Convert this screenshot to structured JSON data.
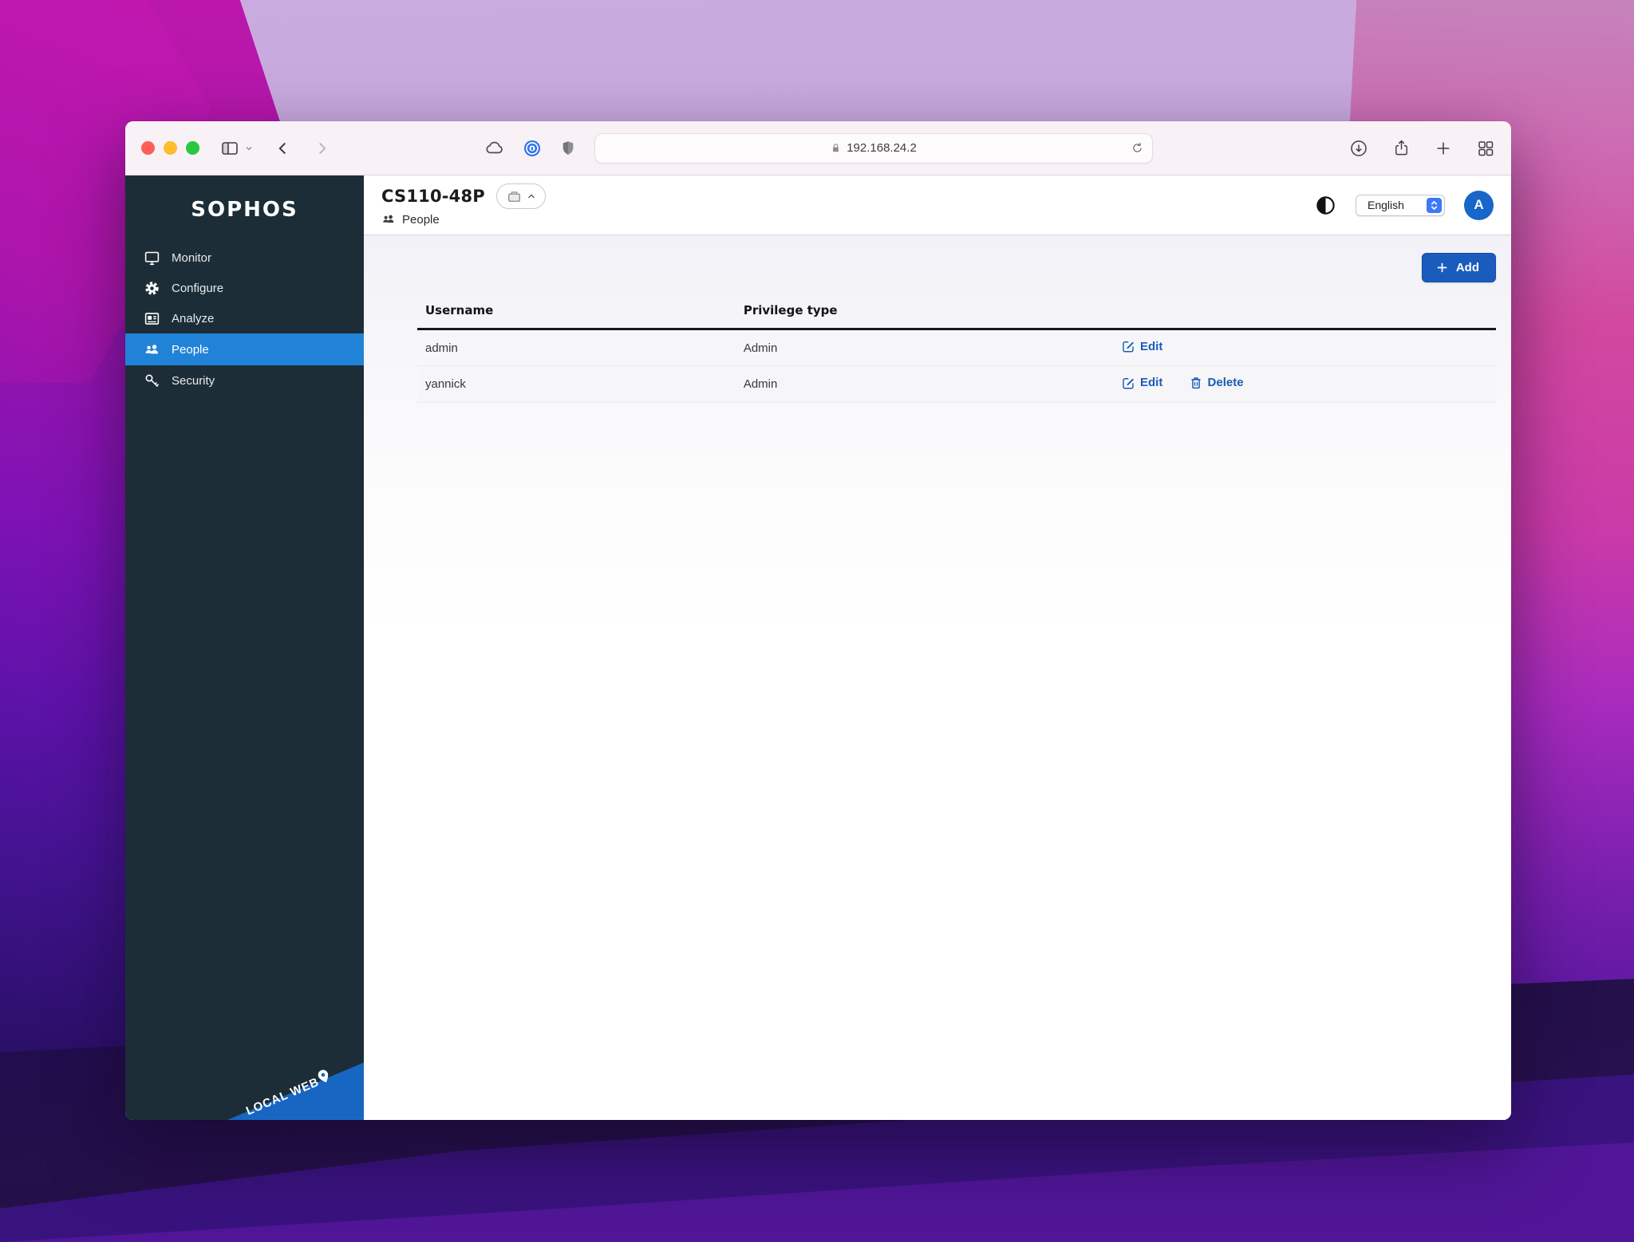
{
  "toolbar": {
    "url": "192.168.24.2"
  },
  "sidebar": {
    "brand": "SOPHOS",
    "items": [
      {
        "label": "Monitor",
        "icon": "monitor-icon",
        "active": false
      },
      {
        "label": "Configure",
        "icon": "gear-icon",
        "active": false
      },
      {
        "label": "Analyze",
        "icon": "report-icon",
        "active": false
      },
      {
        "label": "People",
        "icon": "people-icon",
        "active": true
      },
      {
        "label": "Security",
        "icon": "key-icon",
        "active": false
      }
    ],
    "ribbon_label": "LOCAL WEB"
  },
  "header": {
    "device_name": "CS110-48P",
    "breadcrumb_label": "People",
    "language": "English",
    "avatar_initial": "A"
  },
  "content": {
    "add_label": "Add",
    "table": {
      "columns": [
        "Username",
        "Privilege type"
      ],
      "rows": [
        {
          "username": "admin",
          "privilege": "Admin",
          "actions": [
            "Edit"
          ]
        },
        {
          "username": "yannick",
          "privilege": "Admin",
          "actions": [
            "Edit",
            "Delete"
          ]
        }
      ]
    }
  },
  "colors": {
    "sidebar_bg": "#1d2d37",
    "active_item_blue": "#2183d8",
    "add_button_blue": "#1a5cbd",
    "link_blue": "#1b5bb7",
    "avatar_blue": "#1866c9",
    "ribbon_blue": "#1766c2",
    "select_stepper_blue": "#3b79f5",
    "traffic_red": "#ff5f57",
    "traffic_yellow": "#febc2e",
    "traffic_green": "#28c840",
    "toolbar_bg": "#f8f1f6",
    "row_alt_bg": "#f6f6f8"
  },
  "icons": {
    "people-icon": "two-person silhouette",
    "monitor-icon": "desktop display",
    "gear-icon": "cog wheel",
    "report-icon": "newspaper",
    "key-icon": "key",
    "edit-icon": "pencil in square",
    "delete-icon": "trash can",
    "contrast-icon": "half filled circle",
    "pin-icon": "location pin",
    "lock-icon": "padlock",
    "reload-icon": "circular arrow",
    "cloud-icon": "cloud outline",
    "shield-icon": "privacy shield",
    "onepassword-icon": "blue concentric circles",
    "plus-icon": "+",
    "chevron-up-icon": "^",
    "chevron-down-icon": "v"
  }
}
